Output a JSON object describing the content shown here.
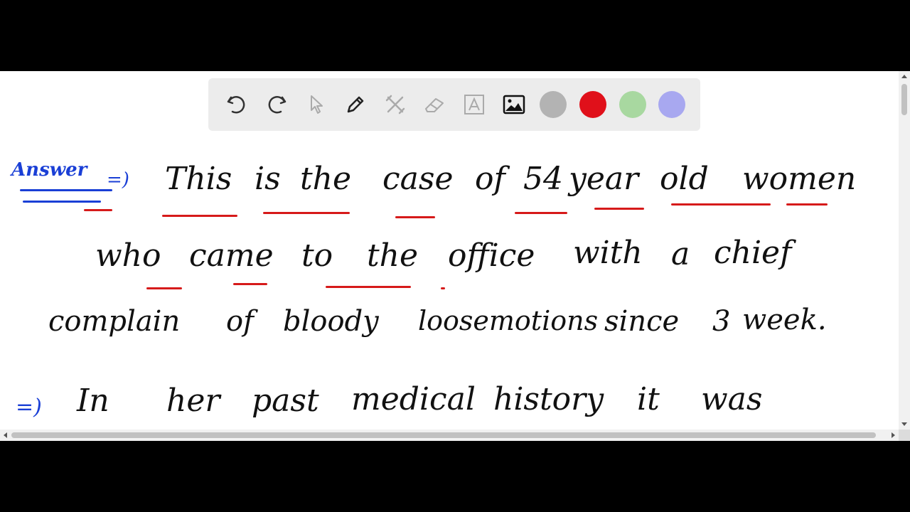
{
  "toolbar": {
    "tools": [
      {
        "name": "undo-icon"
      },
      {
        "name": "redo-icon"
      },
      {
        "name": "pointer-icon"
      },
      {
        "name": "pen-icon"
      },
      {
        "name": "tools-icon"
      },
      {
        "name": "eraser-icon"
      },
      {
        "name": "text-icon"
      },
      {
        "name": "image-icon"
      }
    ],
    "colors": [
      "#b3b3b3",
      "#e0101a",
      "#a8d8a0",
      "#a8a8f0"
    ]
  },
  "notes": {
    "answer_label": "Answer",
    "arrow": "=)",
    "line1": [
      "This",
      "is",
      "the",
      "case",
      "of",
      "54",
      "year",
      "old",
      "women"
    ],
    "line2": [
      "who",
      "came",
      "to",
      "the",
      "office",
      "with",
      "a",
      "chief"
    ],
    "line3": [
      "complain",
      "of",
      "bloody",
      "loosemotions",
      "since",
      "3",
      "week."
    ],
    "line4_arrow": "=)",
    "line4": [
      "In",
      "her",
      "past",
      "medical",
      "history",
      "it",
      "was"
    ]
  }
}
